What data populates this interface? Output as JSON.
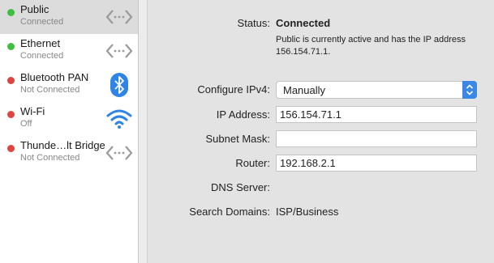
{
  "services": [
    {
      "name": "Public",
      "status": "Connected",
      "dot_color": "#3fbf3f",
      "icon": "ethernet-arrows-icon",
      "selected": true
    },
    {
      "name": "Ethernet",
      "status": "Connected",
      "dot_color": "#3fbf3f",
      "icon": "ethernet-arrows-icon",
      "selected": false
    },
    {
      "name": "Bluetooth PAN",
      "status": "Not Connected",
      "dot_color": "#e0443e",
      "icon": "bluetooth-icon",
      "selected": false
    },
    {
      "name": "Wi-Fi",
      "status": "Off",
      "dot_color": "#e0443e",
      "icon": "wifi-icon",
      "selected": false
    },
    {
      "name": "Thunde…lt Bridge",
      "status": "Not Connected",
      "dot_color": "#e0443e",
      "icon": "ethernet-arrows-icon",
      "selected": false
    }
  ],
  "detail": {
    "status_label": "Status:",
    "status_value": "Connected",
    "status_desc": "Public is currently active and has the IP address 156.154.71.1.",
    "configure_label": "Configure IPv4:",
    "configure_value": "Manually",
    "ip_label": "IP Address:",
    "ip_value": "156.154.71.1",
    "subnet_label": "Subnet Mask:",
    "subnet_value": "",
    "router_label": "Router:",
    "router_value": "192.168.2.1",
    "dns_label": "DNS Server:",
    "dns_value": "",
    "search_label": "Search Domains:",
    "search_value": "ISP/Business"
  },
  "colors": {
    "accent": "#3b87e6",
    "connected": "#3fbf3f",
    "disconnected": "#e0443e"
  }
}
